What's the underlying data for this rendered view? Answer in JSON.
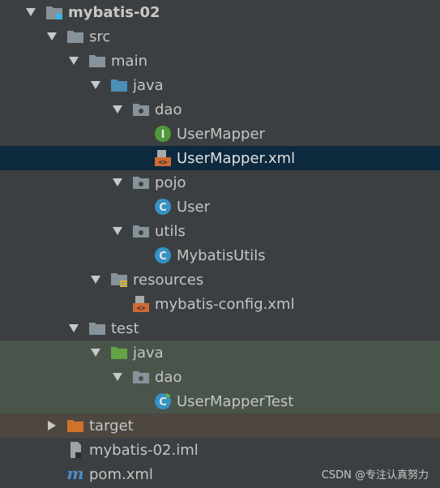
{
  "tree": {
    "root": "mybatis-02",
    "src": "src",
    "main": "main",
    "main_java": "java",
    "dao": "dao",
    "usermapper": "UserMapper",
    "usermapper_xml": "UserMapper.xml",
    "pojo": "pojo",
    "user": "User",
    "utils": "utils",
    "mybatisutils": "MybatisUtils",
    "resources": "resources",
    "config_xml": "mybatis-config.xml",
    "test": "test",
    "test_java": "java",
    "test_dao": "dao",
    "usermappertest": "UserMapperTest",
    "target": "target",
    "iml": "mybatis-02.iml",
    "pom": "pom.xml"
  },
  "icons": {
    "interface_letter": "I",
    "class_letter": "C",
    "maven_letter": "m"
  },
  "watermark": "CSDN @专注认真努力",
  "colors": {
    "background": "#3c3f41",
    "selected_row": "#0d293e",
    "test_row": "#49544a",
    "excluded_row": "#4d4740",
    "folder": "#87939a",
    "source_folder": "#4a8fb8",
    "test_folder": "#62a444",
    "excluded_folder": "#d0722c",
    "class_icon": "#3592c4",
    "interface_icon": "#4f9a38",
    "xml_icon": "#cf6a34"
  }
}
